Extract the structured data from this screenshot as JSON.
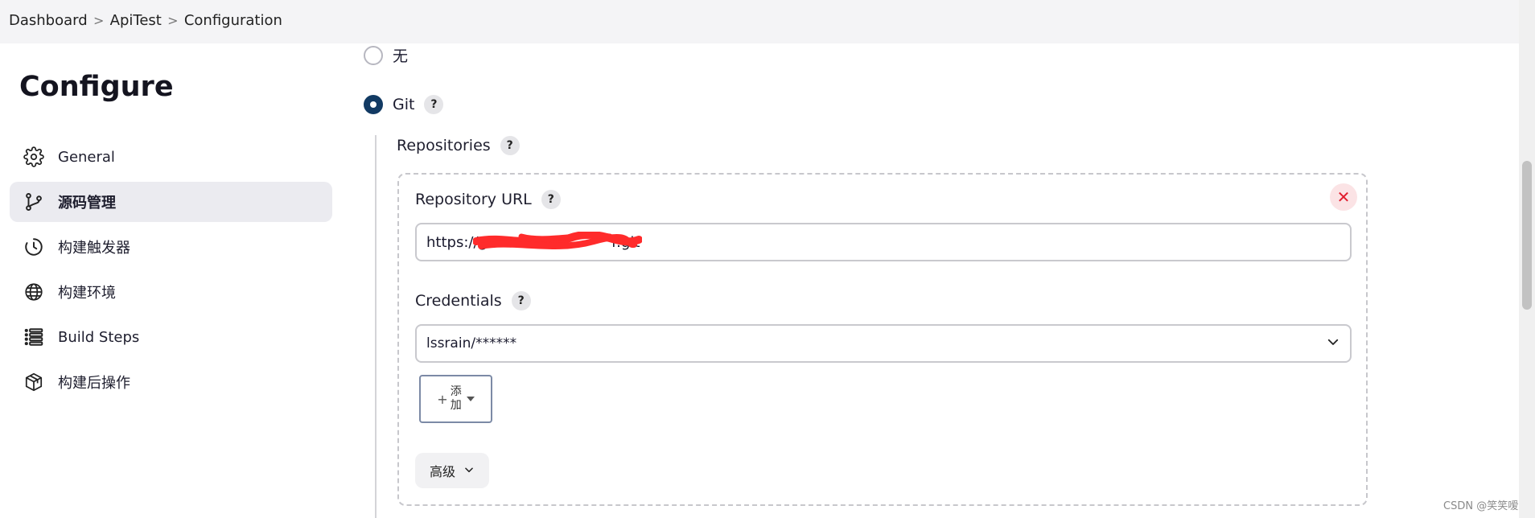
{
  "breadcrumb": {
    "items": [
      "Dashboard",
      "ApiTest",
      "Configuration"
    ],
    "separator": ">"
  },
  "page_title": "Configure",
  "sidebar": {
    "items": [
      {
        "label": "General",
        "icon": "gear-icon",
        "active": false
      },
      {
        "label": "源码管理",
        "icon": "git-branch-icon",
        "active": true
      },
      {
        "label": "构建触发器",
        "icon": "clock-icon",
        "active": false
      },
      {
        "label": "构建环境",
        "icon": "globe-icon",
        "active": false
      },
      {
        "label": "Build Steps",
        "icon": "list-icon",
        "active": false
      },
      {
        "label": "构建后操作",
        "icon": "package-icon",
        "active": false
      }
    ]
  },
  "scm": {
    "options": [
      {
        "label": "无",
        "checked": false
      },
      {
        "label": "Git",
        "checked": true
      }
    ],
    "help_symbol": "?",
    "repositories_label": "Repositories",
    "repository_url_label": "Repository URL",
    "repository_url_value": "https://g                           r.git",
    "credentials_label": "Credentials",
    "credentials_value": "lssrain/******",
    "add_button_label": "添加",
    "add_button_plus": "+",
    "advanced_label": "高级",
    "delete_symbol": "✕"
  },
  "watermark": "CSDN @笑笑嗳",
  "colors": {
    "accent": "#123a63",
    "active_bg": "#ebebf0",
    "delete_red": "#e11d2e",
    "redaction": "#ff2b2b"
  }
}
